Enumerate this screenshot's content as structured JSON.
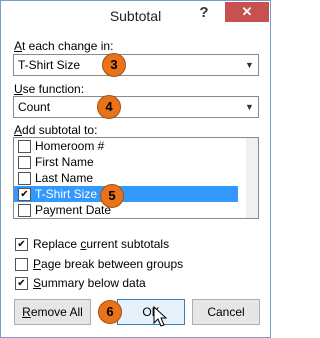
{
  "window": {
    "title": "Subtotal",
    "help_label": "?",
    "close_label": "✕"
  },
  "at_each_change": {
    "label_prefix": "",
    "label_key": "A",
    "label_rest": "t each change in:",
    "value": "T-Shirt Size"
  },
  "use_function": {
    "label_key": "U",
    "label_rest": "se function:",
    "value": "Count"
  },
  "add_subtotal": {
    "label_key": "A",
    "label_rest": "dd subtotal to:",
    "items": [
      {
        "label": "Homeroom #",
        "checked": false
      },
      {
        "label": "First Name",
        "checked": false
      },
      {
        "label": "Last Name",
        "checked": false
      },
      {
        "label": "T-Shirt Size",
        "checked": true,
        "selected": true
      },
      {
        "label": "Payment Date",
        "checked": false
      }
    ]
  },
  "options": {
    "replace": {
      "pre": "Replace ",
      "key": "c",
      "post": "urrent subtotals",
      "checked": true
    },
    "page_break": {
      "pre": "",
      "key": "P",
      "post": "age break between groups",
      "checked": false
    },
    "summary": {
      "pre": "",
      "key": "S",
      "post": "ummary below data",
      "checked": true
    }
  },
  "buttons": {
    "remove_all_key": "R",
    "remove_all_rest": "emove All",
    "ok": "OK",
    "cancel": "Cancel"
  },
  "badges": {
    "b3": "3",
    "b4": "4",
    "b5": "5",
    "b6": "6"
  },
  "colors": {
    "badge": "#e8731a",
    "selection": "#3399ff",
    "close": "#c75050"
  },
  "icons": {
    "checkmark": "✔",
    "dropdown": "▼"
  }
}
